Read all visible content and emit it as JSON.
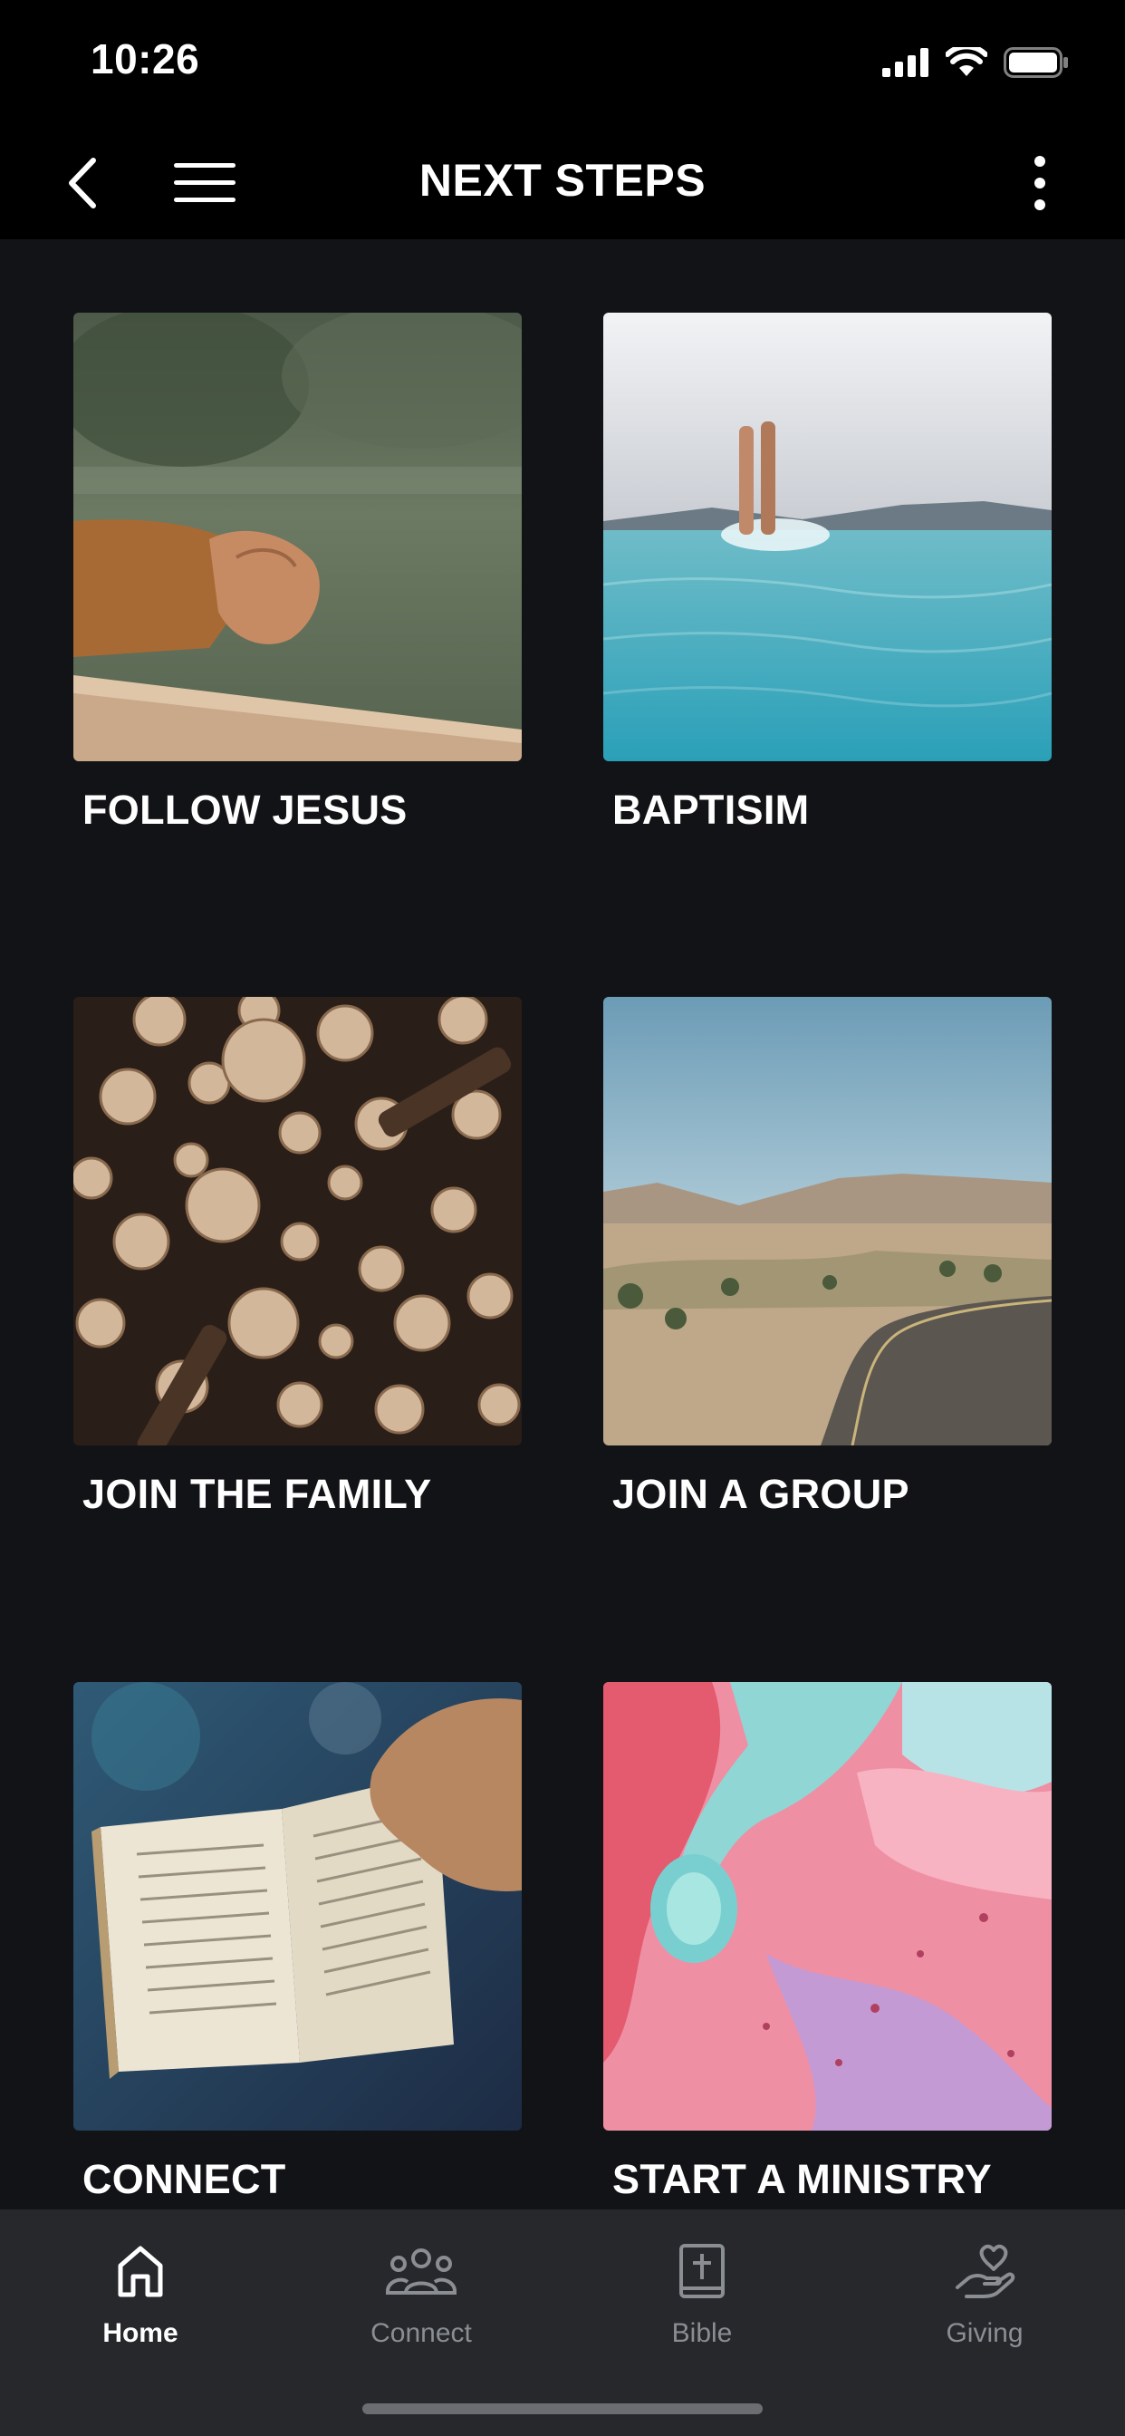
{
  "status": {
    "time": "10:26"
  },
  "header": {
    "title": "NEXT STEPS"
  },
  "cards": [
    {
      "label": "FOLLOW JESUS"
    },
    {
      "label": "BAPTISIM"
    },
    {
      "label": "JOIN THE FAMILY"
    },
    {
      "label": "JOIN A GROUP"
    },
    {
      "label": "CONNECT"
    },
    {
      "label": "START A MINISTRY"
    }
  ],
  "tabs": [
    {
      "label": "Home",
      "icon": "home-icon",
      "active": true
    },
    {
      "label": "Connect",
      "icon": "people-icon",
      "active": false
    },
    {
      "label": "Bible",
      "icon": "bible-icon",
      "active": false
    },
    {
      "label": "Giving",
      "icon": "giving-icon",
      "active": false
    }
  ],
  "colors": {
    "background": "#121316",
    "bars": "#000000",
    "tab_bar": "#26282c",
    "inactive": "#8a8d92"
  }
}
